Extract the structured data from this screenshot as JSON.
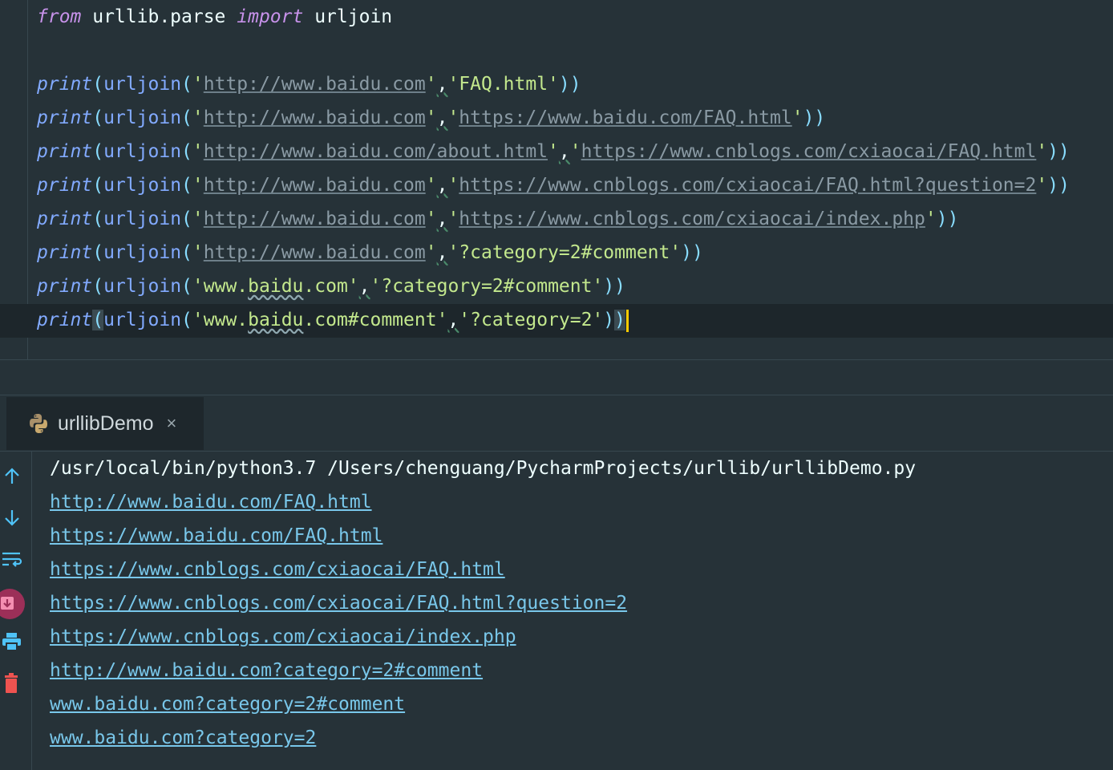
{
  "editor": {
    "code_lines": [
      {
        "parts": [
          {
            "t": "from",
            "c": "kw"
          },
          {
            "t": " urllib.parse ",
            "c": "id"
          },
          {
            "t": "import",
            "c": "kw"
          },
          {
            "t": " urljoin",
            "c": "id"
          }
        ]
      },
      {
        "parts": []
      },
      {
        "parts": [
          {
            "t": "print",
            "c": "fn"
          },
          {
            "t": "(",
            "c": "punc"
          },
          {
            "t": "urljoin",
            "c": "call"
          },
          {
            "t": "(",
            "c": "punc"
          },
          {
            "t": "'",
            "c": "str"
          },
          {
            "t": "http://www.baidu.com",
            "c": "url"
          },
          {
            "t": "'",
            "c": "str"
          },
          {
            "t": ",",
            "c": "sep"
          },
          {
            "t": "'FAQ.html'",
            "c": "str"
          },
          {
            "t": "))",
            "c": "punc"
          }
        ]
      },
      {
        "parts": [
          {
            "t": "print",
            "c": "fn"
          },
          {
            "t": "(",
            "c": "punc"
          },
          {
            "t": "urljoin",
            "c": "call"
          },
          {
            "t": "(",
            "c": "punc"
          },
          {
            "t": "'",
            "c": "str"
          },
          {
            "t": "http://www.baidu.com",
            "c": "url"
          },
          {
            "t": "'",
            "c": "str"
          },
          {
            "t": ",",
            "c": "sep"
          },
          {
            "t": "'",
            "c": "str"
          },
          {
            "t": "https://www.baidu.com/FAQ.html",
            "c": "url"
          },
          {
            "t": "'",
            "c": "str"
          },
          {
            "t": "))",
            "c": "punc"
          }
        ]
      },
      {
        "parts": [
          {
            "t": "print",
            "c": "fn"
          },
          {
            "t": "(",
            "c": "punc"
          },
          {
            "t": "urljoin",
            "c": "call"
          },
          {
            "t": "(",
            "c": "punc"
          },
          {
            "t": "'",
            "c": "str"
          },
          {
            "t": "http://www.baidu.com/about.html",
            "c": "url"
          },
          {
            "t": "'",
            "c": "str"
          },
          {
            "t": ",",
            "c": "sep"
          },
          {
            "t": "'",
            "c": "str"
          },
          {
            "t": "https://www.cnblogs.com/cxiaocai/FAQ.html",
            "c": "url"
          },
          {
            "t": "'",
            "c": "str"
          },
          {
            "t": "))",
            "c": "punc"
          }
        ]
      },
      {
        "parts": [
          {
            "t": "print",
            "c": "fn"
          },
          {
            "t": "(",
            "c": "punc"
          },
          {
            "t": "urljoin",
            "c": "call"
          },
          {
            "t": "(",
            "c": "punc"
          },
          {
            "t": "'",
            "c": "str"
          },
          {
            "t": "http://www.baidu.com",
            "c": "url"
          },
          {
            "t": "'",
            "c": "str"
          },
          {
            "t": ",",
            "c": "sep"
          },
          {
            "t": "'",
            "c": "str"
          },
          {
            "t": "https://www.cnblogs.com/cxiaocai/FAQ.html?question=2",
            "c": "url"
          },
          {
            "t": "'",
            "c": "str"
          },
          {
            "t": "))",
            "c": "punc"
          }
        ]
      },
      {
        "parts": [
          {
            "t": "print",
            "c": "fn"
          },
          {
            "t": "(",
            "c": "punc"
          },
          {
            "t": "urljoin",
            "c": "call"
          },
          {
            "t": "(",
            "c": "punc"
          },
          {
            "t": "'",
            "c": "str"
          },
          {
            "t": "http://www.baidu.com",
            "c": "url"
          },
          {
            "t": "'",
            "c": "str"
          },
          {
            "t": ",",
            "c": "sep"
          },
          {
            "t": "'",
            "c": "str"
          },
          {
            "t": "https://www.cnblogs.com/cxiaocai/index.php",
            "c": "url"
          },
          {
            "t": "'",
            "c": "str"
          },
          {
            "t": "))",
            "c": "punc"
          }
        ]
      },
      {
        "parts": [
          {
            "t": "print",
            "c": "fn"
          },
          {
            "t": "(",
            "c": "punc"
          },
          {
            "t": "urljoin",
            "c": "call"
          },
          {
            "t": "(",
            "c": "punc"
          },
          {
            "t": "'",
            "c": "str"
          },
          {
            "t": "http://www.baidu.com",
            "c": "url"
          },
          {
            "t": "'",
            "c": "str"
          },
          {
            "t": ",",
            "c": "sep"
          },
          {
            "t": "'?category=2#comment'",
            "c": "str"
          },
          {
            "t": "))",
            "c": "punc"
          }
        ]
      },
      {
        "parts": [
          {
            "t": "print",
            "c": "fn"
          },
          {
            "t": "(",
            "c": "punc"
          },
          {
            "t": "urljoin",
            "c": "call"
          },
          {
            "t": "(",
            "c": "punc"
          },
          {
            "t": "'www.",
            "c": "str"
          },
          {
            "t": "baidu",
            "c": "str typo"
          },
          {
            "t": ".com'",
            "c": "str"
          },
          {
            "t": ",",
            "c": "sep"
          },
          {
            "t": "'?category=2#comment'",
            "c": "str"
          },
          {
            "t": "))",
            "c": "punc"
          }
        ]
      },
      {
        "parts": [
          {
            "t": "print",
            "c": "fn"
          },
          {
            "t": "(",
            "c": "punc bracket-hl"
          },
          {
            "t": "urljoin",
            "c": "call"
          },
          {
            "t": "(",
            "c": "punc"
          },
          {
            "t": "'www.",
            "c": "str"
          },
          {
            "t": "baidu",
            "c": "str typo"
          },
          {
            "t": ".com#comment'",
            "c": "str"
          },
          {
            "t": ",",
            "c": "sep"
          },
          {
            "t": "'?category=2'",
            "c": "str"
          },
          {
            "t": ")",
            "c": "punc"
          },
          {
            "t": ")",
            "c": "punc bracket-hl"
          }
        ],
        "caret": true
      }
    ]
  },
  "run_panel": {
    "tab_label": "urllibDemo",
    "tab_close": "×",
    "tab_icon": "python-icon",
    "tools": [
      "arrow-up-icon",
      "arrow-down-icon",
      "soft-wrap-icon",
      "scroll-to-end-icon",
      "print-icon",
      "trash-icon"
    ],
    "console_lines": [
      {
        "text": "/usr/local/bin/python3.7 /Users/chenguang/PycharmProjects/urllib/urllibDemo.py",
        "kind": "cmd"
      },
      {
        "text": "http://www.baidu.com/FAQ.html",
        "kind": "link"
      },
      {
        "text": "https://www.baidu.com/FAQ.html",
        "kind": "link"
      },
      {
        "text": "https://www.cnblogs.com/cxiaocai/FAQ.html",
        "kind": "link"
      },
      {
        "text": "https://www.cnblogs.com/cxiaocai/FAQ.html?question=2",
        "kind": "link"
      },
      {
        "text": "https://www.cnblogs.com/cxiaocai/index.php",
        "kind": "link"
      },
      {
        "text": "http://www.baidu.com?category=2#comment",
        "kind": "link"
      },
      {
        "text": "www.baidu.com?category=2#comment",
        "kind": "link"
      },
      {
        "text": "www.baidu.com?category=2",
        "kind": "link"
      }
    ]
  },
  "colors": {
    "background": "#263238",
    "keyword": "#c792ea",
    "function": "#82aaff",
    "string": "#c3e88d",
    "link": "#79c7ea",
    "caret": "#ffcc00"
  }
}
